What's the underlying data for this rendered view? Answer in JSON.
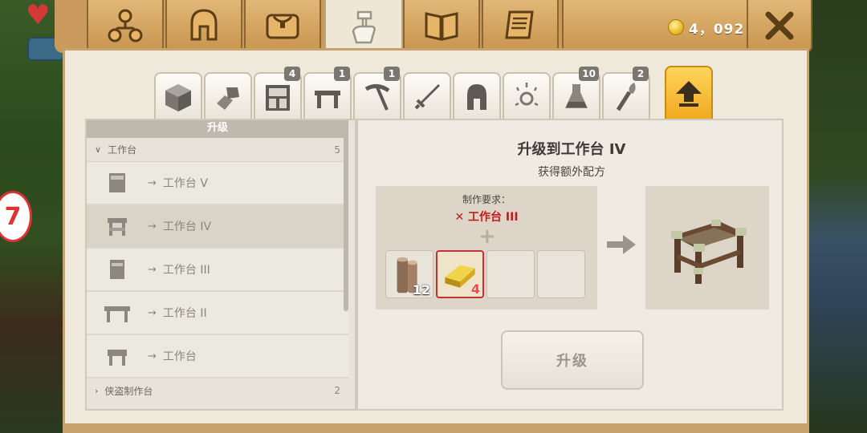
{
  "coins": {
    "amount": "4，092"
  },
  "side_badge": "7",
  "category_badges": {
    "furniture": "4",
    "table": "1",
    "tools": "1",
    "potions": "10",
    "torch": "2"
  },
  "list": {
    "header": "升级",
    "groups": [
      {
        "label": "工作台",
        "count": "5",
        "chevron": "∨"
      },
      {
        "label": "侠盗制作台",
        "count": "2",
        "chevron": "›"
      }
    ],
    "items": [
      {
        "label": "工作台 V",
        "arrow": "→"
      },
      {
        "label": "工作台 IV",
        "arrow": "→"
      },
      {
        "label": "工作台 III",
        "arrow": "→"
      },
      {
        "label": "工作台 II",
        "arrow": "→"
      },
      {
        "label": "工作台",
        "arrow": "→"
      }
    ]
  },
  "detail": {
    "title": "升级到工作台 IV",
    "subtitle": "获得额外配方",
    "requirements_label": "制作要求：",
    "requirement_fail": "✕ 工作台 III",
    "plus": "+",
    "ingredients": [
      {
        "name": "wood-log-icon",
        "qty": "12"
      },
      {
        "name": "gold-ingot-icon",
        "qty": "4"
      }
    ],
    "upgrade_button": "升级"
  },
  "colors": {
    "accent": "#f0a820",
    "wood": "#c99a5c",
    "error": "#c41a1a"
  }
}
